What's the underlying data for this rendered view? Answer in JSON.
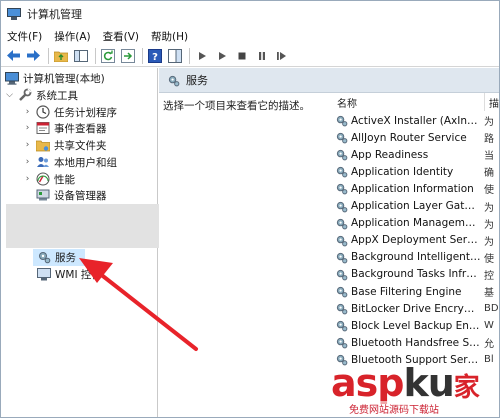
{
  "window": {
    "title": "计算机管理"
  },
  "menu": [
    {
      "label": "文件(F)"
    },
    {
      "label": "操作(A)"
    },
    {
      "label": "查看(V)"
    },
    {
      "label": "帮助(H)"
    }
  ],
  "toolbar": {
    "icons": [
      "back-arrow-icon",
      "forward-arrow-icon",
      "up-folder-icon",
      "show-tree-icon",
      "refresh-icon",
      "export-icon",
      "help-icon",
      "panel-icon",
      "play-icon",
      "play-alt-icon",
      "stop-icon",
      "pause-icon",
      "restart-icon"
    ]
  },
  "tree": {
    "root": "计算机管理(本地)",
    "system_tools": "系统工具",
    "items": [
      {
        "label": "任务计划程序"
      },
      {
        "label": "事件查看器"
      },
      {
        "label": "共享文件夹"
      },
      {
        "label": "本地用户和组"
      },
      {
        "label": "性能"
      },
      {
        "label": "设备管理器"
      }
    ],
    "services": "服务",
    "wmi": "WMI 控件"
  },
  "content": {
    "header": "服务",
    "description": "选择一个项目来查看它的描述。",
    "col_name": "名称",
    "col_desc": "描",
    "services": [
      {
        "name": "ActiveX Installer (AxInstSV)",
        "desc": "为"
      },
      {
        "name": "AllJoyn Router Service",
        "desc": "路"
      },
      {
        "name": "App Readiness",
        "desc": "当"
      },
      {
        "name": "Application Identity",
        "desc": "确"
      },
      {
        "name": "Application Information",
        "desc": "使"
      },
      {
        "name": "Application Layer Gatewa...",
        "desc": "为"
      },
      {
        "name": "Application Management",
        "desc": "为"
      },
      {
        "name": "AppX Deployment Servic...",
        "desc": "为"
      },
      {
        "name": "Background Intelligent T...",
        "desc": "使"
      },
      {
        "name": "Background Tasks Infras...",
        "desc": "控"
      },
      {
        "name": "Base Filtering Engine",
        "desc": "基"
      },
      {
        "name": "BitLocker Drive Encryptio...",
        "desc": "BD"
      },
      {
        "name": "Block Level Backup Engi...",
        "desc": "W"
      },
      {
        "name": "Bluetooth Handsfree Serv...",
        "desc": "允"
      },
      {
        "name": "Bluetooth Support Service",
        "desc": "Bl"
      }
    ]
  },
  "watermark": {
    "brand_a": "asp",
    "brand_k": "ku",
    "brand_z": "家",
    "sub": "免费网站源码下载站"
  },
  "colors": {
    "header_bg": "#dfe7ef",
    "selection": "#cde8ff",
    "arrow": "#e8232a"
  }
}
